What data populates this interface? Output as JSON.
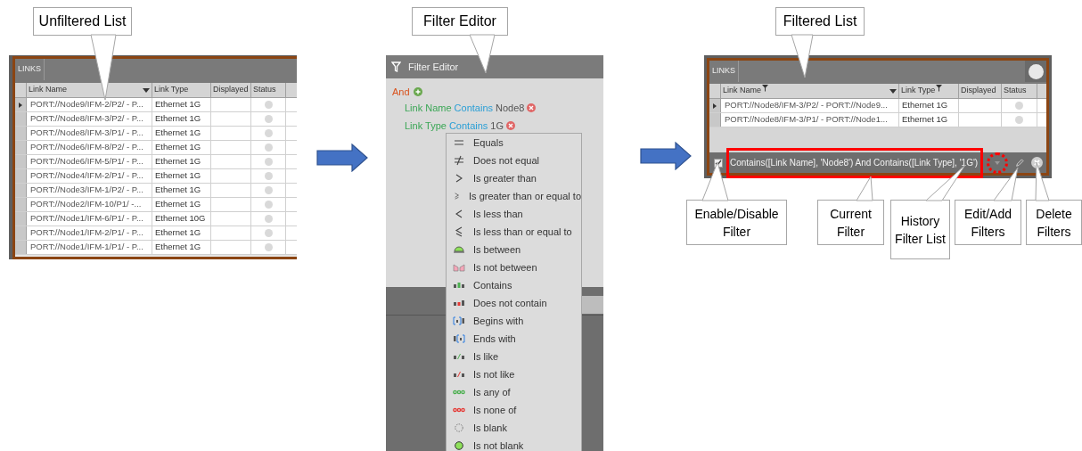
{
  "unfiltered": {
    "callout": "Unfiltered List",
    "tab": "LINKS",
    "columns": [
      {
        "label": "Link Name",
        "sort_menu": true,
        "filtered": false
      },
      {
        "label": "Link Type",
        "sort_menu": false,
        "filtered": false
      },
      {
        "label": "Displayed",
        "sort_menu": false,
        "filtered": false
      },
      {
        "label": "Status",
        "sort_menu": false,
        "filtered": false
      }
    ],
    "rows": [
      {
        "name": "PORT://Node9/IFM-2/P2/ - P...",
        "type": "Ethernet 1G",
        "selected": true
      },
      {
        "name": "PORT://Node8/IFM-3/P2/ - P...",
        "type": "Ethernet 1G",
        "selected": false
      },
      {
        "name": "PORT://Node8/IFM-3/P1/ - P...",
        "type": "Ethernet 1G",
        "selected": false
      },
      {
        "name": "PORT://Node6/IFM-8/P2/ - P...",
        "type": "Ethernet 1G",
        "selected": false
      },
      {
        "name": "PORT://Node6/IFM-5/P1/ - P...",
        "type": "Ethernet 1G",
        "selected": false
      },
      {
        "name": "PORT://Node4/IFM-2/P1/ - P...",
        "type": "Ethernet 1G",
        "selected": false
      },
      {
        "name": "PORT://Node3/IFM-1/P2/ - P...",
        "type": "Ethernet 1G",
        "selected": false
      },
      {
        "name": "PORT://Node2/IFM-10/P1/ -...",
        "type": "Ethernet 1G",
        "selected": false
      },
      {
        "name": "PORT://Node1/IFM-6/P1/ - P...",
        "type": "Ethernet 10G",
        "selected": false
      },
      {
        "name": "PORT://Node1/IFM-2/P1/ - P...",
        "type": "Ethernet 1G",
        "selected": false
      },
      {
        "name": "PORT://Node1/IFM-1/P1/ - P...",
        "type": "Ethernet 1G",
        "selected": false
      }
    ]
  },
  "filter_editor": {
    "callout": "Filter Editor",
    "title": "Filter Editor",
    "group": "And",
    "conditions": [
      {
        "field": "Link Name",
        "operator": "Contains",
        "value": "Node8"
      },
      {
        "field": "Link Type",
        "operator": "Contains",
        "value": "1G"
      }
    ],
    "operators": [
      {
        "label": "Equals",
        "kind": "equals"
      },
      {
        "label": "Does not equal",
        "kind": "not_equal"
      },
      {
        "label": "Is greater than",
        "kind": "greater"
      },
      {
        "label": "Is greater than or equal to",
        "kind": "greater_equal"
      },
      {
        "label": "Is less than",
        "kind": "less"
      },
      {
        "label": "Is less than or equal to",
        "kind": "less_equal"
      },
      {
        "label": "Is between",
        "kind": "between"
      },
      {
        "label": "Is not between",
        "kind": "not_between"
      },
      {
        "label": "Contains",
        "kind": "contains"
      },
      {
        "label": "Does not contain",
        "kind": "not_contain"
      },
      {
        "label": "Begins with",
        "kind": "begins"
      },
      {
        "label": "Ends with",
        "kind": "ends"
      },
      {
        "label": "Is like",
        "kind": "like"
      },
      {
        "label": "Is not like",
        "kind": "not_like"
      },
      {
        "label": "Is any of",
        "kind": "any_of"
      },
      {
        "label": "Is none of",
        "kind": "none_of"
      },
      {
        "label": "Is blank",
        "kind": "blank"
      },
      {
        "label": "Is not blank",
        "kind": "not_blank"
      }
    ]
  },
  "filtered": {
    "callout": "Filtered List",
    "tab": "LINKS",
    "columns": [
      {
        "label": "Link Name",
        "sort_menu": true,
        "filtered": true
      },
      {
        "label": "Link Type",
        "sort_menu": false,
        "filtered": true
      },
      {
        "label": "Displayed",
        "sort_menu": false,
        "filtered": false
      },
      {
        "label": "Status",
        "sort_menu": false,
        "filtered": false
      }
    ],
    "rows": [
      {
        "name": "PORT://Node8/IFM-3/P2/ - PORT://Node9...",
        "type": "Ethernet 1G",
        "selected": true
      },
      {
        "name": "PORT://Node8/IFM-3/P1/ - PORT://Node1...",
        "type": "Ethernet 1G",
        "selected": false
      }
    ],
    "filter_bar": {
      "enabled": true,
      "expression": "Contains([Link Name], 'Node8') And Contains([Link Type], '1G')"
    },
    "annotations": [
      "Enable/Disable Filter",
      "Current Filter",
      "History Filter List",
      "Edit/Add Filters",
      "Delete Filters"
    ]
  }
}
